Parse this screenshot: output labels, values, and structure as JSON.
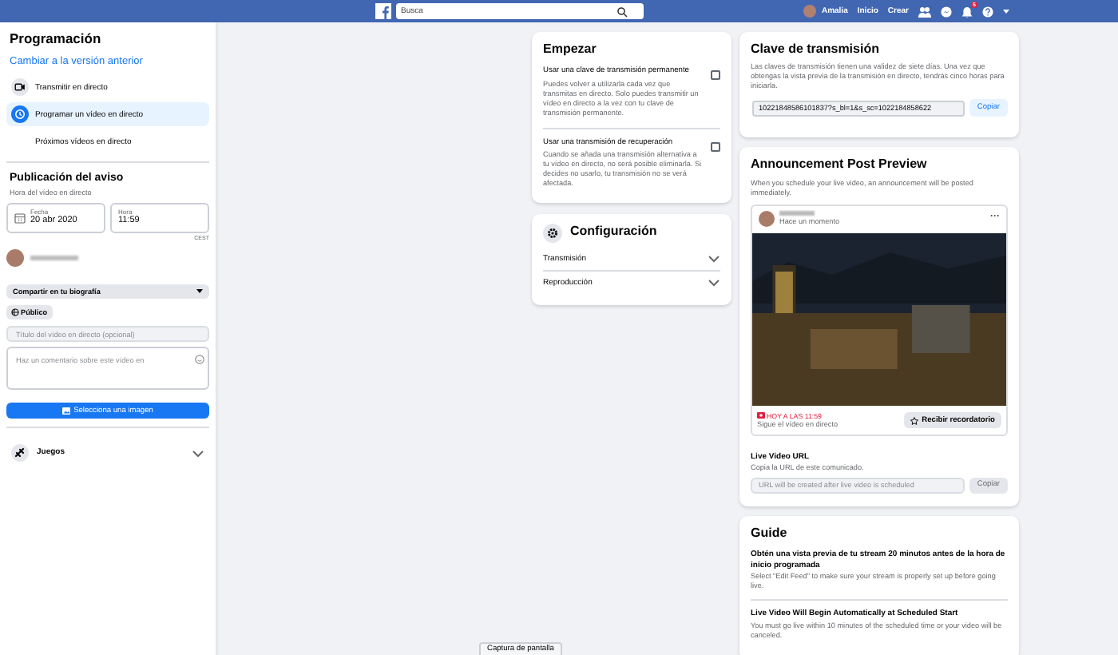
{
  "top_bar": {
    "search": {
      "placeholder": "Busca"
    },
    "user_name": "Amalia",
    "nav": [
      "Inicio",
      "Crear"
    ],
    "notification_badge": "5"
  },
  "sidebar": {
    "title": "Programación",
    "switch_link": "Cambiar a la versión anterior",
    "items": [
      {
        "kind": "camera",
        "label": "Transmitir en directo",
        "selected": false
      },
      {
        "kind": "clock",
        "label": "Programar un vídeo en directo",
        "selected": true
      },
      {
        "kind": "none",
        "label": "Próximos vídeos en directo",
        "selected": false
      }
    ],
    "announcement": {
      "title": "Publicación del aviso",
      "subtitle": "Hora del vídeo en directo",
      "date": {
        "label": "Fecha",
        "value": "20 abr 2020"
      },
      "time": {
        "label": "Hora",
        "value": "11:59"
      },
      "timezone": "CEST"
    },
    "share_select": "Compartir en tu biografía",
    "privacy": "Público",
    "title_field": {
      "placeholder": "Título del vídeo en directo (opcional)"
    },
    "comment_field": {
      "placeholder": "Haz un comentario sobre este vídeo en"
    },
    "image_button": "Selecciona una imagen",
    "games": "Juegos"
  },
  "start_card": {
    "title": "Empezar",
    "options": [
      {
        "title": "Usar una clave de transmisión permanente",
        "description": "Puedes volver a utilizarla cada vez que transmitas en directo. Solo puedes transmitir un vídeo en directo a la vez con tu clave de transmisión permanente.",
        "checked": false
      },
      {
        "title": "Usar una transmisión de recuperación",
        "description": "Cuando se añada una transmisión alternativa a tu vídeo en directo, no será posible eliminarla. Si decides no usarlo, tu transmisión no se verá afectada.",
        "checked": false
      }
    ]
  },
  "settings_card": {
    "title": "Configuración",
    "sections": [
      "Transmisión",
      "Reproducción"
    ]
  },
  "stream_key_card": {
    "title": "Clave de transmisión",
    "description": "Las claves de transmisión tienen una validez de siete días. Una vez que obtengas la vista previa de la transmisión en directo, tendrás cinco horas para iniciarla.",
    "key": "10221848586101837?s_bl=1&s_sc=1022184858622",
    "copy_button": "Copiar"
  },
  "preview_card": {
    "title": "Announcement Post Preview",
    "description": "When you schedule your live video, an announcement will be posted immediately.",
    "post": {
      "time": "Hace un momento",
      "more": "···",
      "live_time": "HOY A LAS 11:59",
      "follow_text": "Sigue el vídeo en directo",
      "reminder_button": "Recibir recordatorio"
    },
    "url_section": {
      "title": "Live Video URL",
      "description": "Copia la URL de este comunicado.",
      "placeholder": "URL will be created after live video is scheduled",
      "copy_button": {
        "label": "Copiar",
        "disabled": true
      }
    }
  },
  "guide_card": {
    "title": "Guide",
    "items": [
      {
        "title": "Obtén una vista previa de tu stream 20 minutos antes de la hora de inicio programada",
        "description": "Select \"Edit Feed\" to make sure your stream is properly set up before going live."
      },
      {
        "title": "Live Video Will Begin Automatically at Scheduled Start",
        "description": "You must go live within 10 minutes of the scheduled time or your video will be canceled."
      }
    ]
  },
  "screenshot_button": "Captura de pantalla"
}
